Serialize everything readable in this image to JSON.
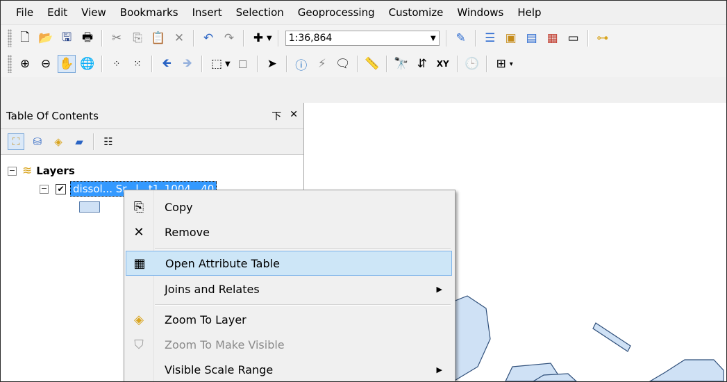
{
  "menu": [
    "File",
    "Edit",
    "View",
    "Bookmarks",
    "Insert",
    "Selection",
    "Geoprocessing",
    "Customize",
    "Windows",
    "Help"
  ],
  "toolbar": {
    "scale_value": "1:36,864",
    "buttons_row1": [
      "new-document-icon",
      "open-folder-icon",
      "save-icon",
      "print-icon",
      "cut-icon",
      "copy-icon",
      "paste-icon",
      "delete-icon",
      "undo-icon",
      "redo-icon",
      "add-data-icon"
    ],
    "buttons_row2": [
      "zoom-in-icon",
      "zoom-out-icon",
      "pan-icon",
      "full-extent-icon",
      "fixed-zoom-in-icon",
      "fixed-zoom-out-icon",
      "back-icon",
      "forward-icon",
      "select-features-icon",
      "clear-selection-icon",
      "select-elements-icon",
      "identify-icon",
      "hyperlink-icon",
      "html-popup-icon",
      "measure-icon",
      "find-icon",
      "find-route-icon",
      "go-to-xy-icon",
      "time-slider-icon",
      "create-viewer-icon"
    ]
  },
  "toc": {
    "title": "Table Of Contents",
    "pin_glyph": "下",
    "close_glyph": "✕",
    "root_label": "Layers",
    "layer_label": "dissol... Sr...l...t1_1004...40"
  },
  "context_menu": {
    "items": [
      {
        "label": "Copy",
        "icon": "copy-icon"
      },
      {
        "label": "Remove",
        "icon": "remove-x-icon"
      },
      {
        "label": "Open Attribute Table",
        "icon": "attribute-table-icon",
        "highlighted": true
      },
      {
        "label": "Joins and Relates",
        "submenu": true
      },
      {
        "label": "Zoom To Layer",
        "icon": "zoom-to-layer-icon"
      },
      {
        "label": "Zoom To Make Visible",
        "icon": "zoom-visible-icon",
        "disabled": true
      },
      {
        "label": "Visible Scale Range",
        "submenu": true
      }
    ]
  },
  "colors": {
    "selection": "#3399ff",
    "highlight": "#cde6f7",
    "polygon_fill": "#cfe1f5",
    "polygon_stroke": "#2f4f7a"
  }
}
